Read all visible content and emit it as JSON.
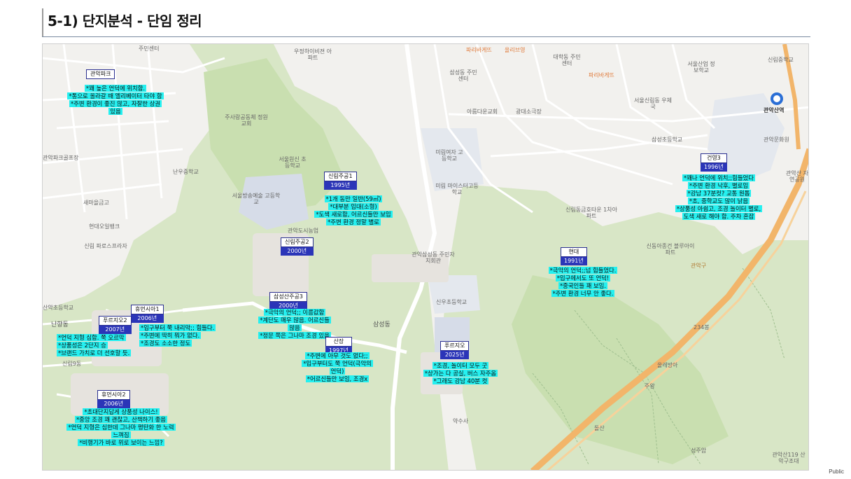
{
  "slide": {
    "title": "5-1) 단지분석 - 단임 정리",
    "public": "Public"
  },
  "colors": {
    "highlight": "#25f0f0",
    "badge_blue": "#2b35b8",
    "road_orange": "#f2b56a",
    "green": "#c9dfb0"
  },
  "pois": [
    "주민센터",
    "우정하이비젼 아파트",
    "파리바게뜨",
    "올리브영",
    "대학동 주민센터",
    "파리바게뜨",
    "서울산업 정보학교",
    "신림중학교",
    "삼성동 주민센터",
    "아름다운교회",
    "광대소극장",
    "서울신림동 우체국",
    "관악산역",
    "주사랑공동체 정원교회",
    "관악문화원",
    "관악파크골프장",
    "서울원신 초등학교",
    "난우중학교",
    "미림여자 고등학교",
    "미림 마이스터고등학교",
    "삼성초등학교",
    "서울방송예술 고등학교",
    "새마을금고",
    "현대오일뱅크",
    "관악도시농업",
    "신림동금호타운 1차아파트",
    "신림 파로스프라자",
    "관악삼성동 주민자치회관",
    "신동아종건 블루아이파트",
    "산악초등학교",
    "난향동",
    "신우초등학교",
    "삼성동",
    "234봉",
    "관악구",
    "신림9동",
    "올레방아",
    "주왕",
    "약수사",
    "돌산",
    "성주암",
    "관악산119 산악구조대",
    "관악산 자연공원"
  ],
  "complexes": [
    {
      "name": "관악파크",
      "year": "2003년",
      "notes": [
        "*꽤 높은 언덕에 위치함.",
        "*통으로 올라갈 때 엘리베이터 타야 함",
        "*주변 환경이 좋진 않고, 자잘한 상권",
        "있음"
      ]
    },
    {
      "name": "신림주공1",
      "year": "1995년",
      "notes": [
        "*1개 동만 일반(59㎡)",
        "*대부분 임대(소형)",
        "*도색 새로함, 어르신들만 보임",
        "*주변 환경 정말 별로"
      ]
    },
    {
      "name": "신림주공2",
      "year": "2000년",
      "notes": []
    },
    {
      "name": "삼성산주공3",
      "year": "2000년",
      "notes": [
        "*극악의 언덕;; 이름값함",
        "*계단도 매우 많음. 어르신들",
        "많음",
        "*정문 쪽은 그나마 조경 있음"
      ]
    },
    {
      "name": "휴먼시아1",
      "year": "2006년",
      "notes": [
        "*입구부터 쭉 내리막;; 힘들다.",
        "*주변에 딱히 뭐가 없다.",
        "*조경도 소소한 정도"
      ]
    },
    {
      "name": "푸르지오2",
      "year": "2007년",
      "notes": [
        "*언덕 지형 심함. 쭉 오르막",
        "*상품성은 2단지 승",
        "*브랜드 가치로 더 선호할 듯."
      ]
    },
    {
      "name": "산장",
      "year": "1997년",
      "notes": [
        "*주변에 아무 것도 없다;;",
        "*입구부터도 쭉 언덕(극악의",
        "언덕)",
        "*어르신들만 보임, 조경x"
      ]
    },
    {
      "name": "푸르지오",
      "year": "2025년",
      "notes": [
        "*조경, 놀이터 모두 굿",
        "*상가는 다 공실, 버스 자주옴",
        "*그래도 강남 40분 컷"
      ]
    },
    {
      "name": "휴먼시아2",
      "year": "2006년",
      "notes": [
        "*초대단지답게 상품성 나이스!",
        "*중앙 조경 꽤 괜찮고, 산책하기 좋음",
        "*언덕 지형은 심한데 그나마 평탄화 한 노력",
        "느껴짐",
        "*비행기가 바로 위로 보이는 느낌?"
      ]
    },
    {
      "name": "현대",
      "year": "1991년",
      "notes": [
        "*극악의 언덕;;넘 힘들었다.",
        "*입구에서도 또 언덕!",
        "*중국인들 꽤 보임.",
        "*주변 환경 너무 안 좋다."
      ]
    },
    {
      "name": "건영3",
      "year": "1996년",
      "notes": [
        "*꽤나 언덕에 위치;;힘들었다",
        "*주변 환경 낙후, 별로임",
        "*강남 37분컷? 교통 원톱",
        "*초, 중학교도 많이 낡음",
        "*상품성 아쉽고, 조경 놀이터 별로,",
        "도색 새로 해야 함. 주차 혼잡"
      ]
    }
  ]
}
